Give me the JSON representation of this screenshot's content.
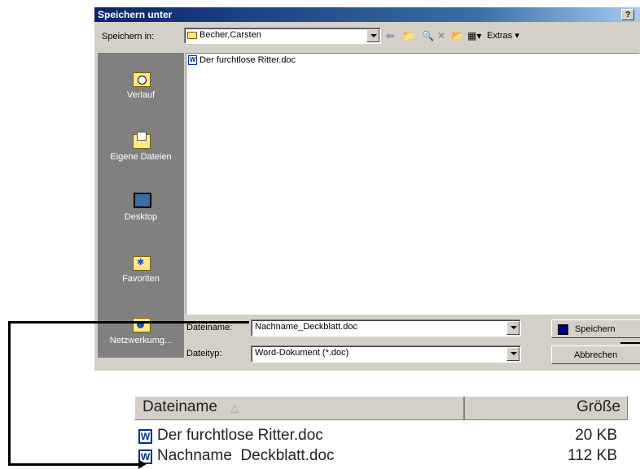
{
  "dialog": {
    "title": "Speichern unter",
    "help_label": "?",
    "save_in_label": "Speichern in:",
    "current_folder": "Becher,Carsten",
    "toolbar": {
      "extras_label": "Extras"
    },
    "places": [
      {
        "label": "Verlauf",
        "icon": "history-icon"
      },
      {
        "label": "Eigene Dateien",
        "icon": "my-documents-icon"
      },
      {
        "label": "Desktop",
        "icon": "desktop-icon"
      },
      {
        "label": "Favoriten",
        "icon": "favorites-icon"
      },
      {
        "label": "Netzwerkumg...",
        "icon": "network-icon"
      }
    ],
    "files": [
      {
        "name": "Der furchtlose Ritter.doc"
      }
    ],
    "filename_label": "Dateiname:",
    "filename_value": "Nachname_Deckblatt.doc",
    "filetype_label": "Dateityp:",
    "filetype_value": "Word-Dokument (*.doc)",
    "save_button": "Speichern",
    "cancel_button": "Abbrechen"
  },
  "zoom_list": {
    "col_name": "Dateiname",
    "col_size": "Größe",
    "rows": [
      {
        "name": "Der furchtlose Ritter.doc",
        "size": "20 KB"
      },
      {
        "name": "Nachname  Deckblatt.doc",
        "size": "112 KB"
      }
    ]
  }
}
